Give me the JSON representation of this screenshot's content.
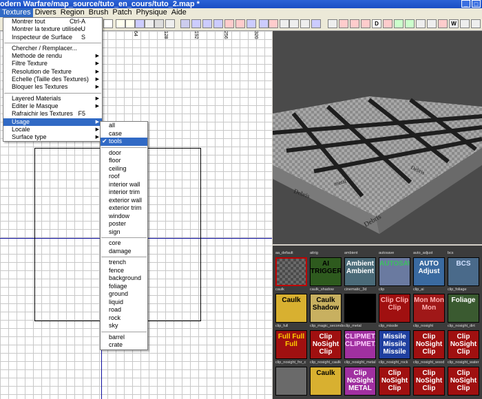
{
  "window": {
    "title": "odern Warfare/map_source/tuto_en_cours/tuto_2.map *"
  },
  "menubar": [
    "Textures",
    "Divers",
    "Region",
    "Brush",
    "Patch",
    "Physique",
    "Aide"
  ],
  "textures_menu": {
    "group1": [
      {
        "label": "Montrer tout",
        "shortcut": "Ctrl-A"
      },
      {
        "label": "Montrer la texture utilisée",
        "shortcut": "U"
      },
      {
        "label": "Inspecteur de Surface",
        "shortcut": "S"
      }
    ],
    "group2": [
      {
        "label": "Chercher / Remplacer..."
      },
      {
        "label": "Methode de rendu",
        "submenu": true
      },
      {
        "label": "Filtre Texture",
        "submenu": true
      },
      {
        "label": "Resolution de Texture",
        "submenu": true
      },
      {
        "label": "Echelle (Taille des Textures)",
        "submenu": true
      },
      {
        "label": "Bloquer les Textures",
        "submenu": true
      }
    ],
    "group3": [
      {
        "label": "Layered Materials",
        "submenu": true
      },
      {
        "label": "Editer le Masque",
        "submenu": true
      },
      {
        "label": "Rafraichir les Textures",
        "shortcut": "F5"
      },
      {
        "label": "Usage",
        "submenu": true,
        "highlighted": true
      },
      {
        "label": "Locale",
        "submenu": true
      },
      {
        "label": "Surface type",
        "submenu": true
      }
    ]
  },
  "usage_submenu": {
    "group1": [
      "all",
      "case",
      "tools"
    ],
    "selected": "tools",
    "group2": [
      "door",
      "floor",
      "ceiling",
      "roof",
      "interior wall",
      "interior trim",
      "exterior wall",
      "exterior trim",
      "window",
      "poster",
      "sign"
    ],
    "group3": [
      "core",
      "damage"
    ],
    "group4": [
      "trench",
      "fence",
      "background",
      "foliage",
      "ground",
      "liquid",
      "road",
      "rock",
      "sky"
    ],
    "group5": [
      "barrel",
      "crate"
    ]
  },
  "ruler_labels": [
    "64",
    "128",
    "192",
    "256",
    "320"
  ],
  "textures": [
    {
      "name": "aa_default",
      "text": "",
      "bg": "#5a5a5a",
      "fg": "#fff",
      "border": "#c00000"
    },
    {
      "name": "aitrig",
      "text": "AI TRIGGER",
      "bg": "#2e5a1e",
      "fg": "#000",
      "border": "#000"
    },
    {
      "name": "ambient",
      "text": "Ambient Ambient",
      "bg": "#4a6a78",
      "fg": "#fff",
      "border": "#000"
    },
    {
      "name": "autosave",
      "text": "AUTOSAVE",
      "bg": "#6a7aa0",
      "fg": "#3cc060",
      "border": "#000"
    },
    {
      "name": "auto_adjust",
      "text": "AUTO Adjust",
      "bg": "#3a6aa0",
      "fg": "#fff",
      "border": "#000"
    },
    {
      "name": "bcs",
      "text": "BCS",
      "bg": "#4a6a8a",
      "fg": "#d0e0ff",
      "border": "#000"
    },
    {
      "name": "caulk",
      "text": "Caulk",
      "bg": "#d8b030",
      "fg": "#000",
      "border": "#000"
    },
    {
      "name": "caulk_shadow",
      "text": "Caulk Shadow",
      "bg": "#c8b060",
      "fg": "#000",
      "border": "#000"
    },
    {
      "name": "cinematic_3d",
      "text": "",
      "bg": "#000",
      "fg": "#fff",
      "border": "#000"
    },
    {
      "name": "clip",
      "text": "Clip Clip Clip",
      "bg": "#a01010",
      "fg": "#ffb0b0",
      "border": "#000"
    },
    {
      "name": "clip_ai",
      "text": "Mon Mon Mon",
      "bg": "#a01818",
      "fg": "#ffb0b0",
      "border": "#000"
    },
    {
      "name": "clip_foliage",
      "text": "Foliage",
      "bg": "#3a5a30",
      "fg": "#ffffff",
      "border": "#000"
    },
    {
      "name": "clip_full",
      "text": "Full Full Full",
      "bg": "#a01010",
      "fg": "#ffd000",
      "border": "#000"
    },
    {
      "name": "clip_missile",
      "text": "Clip NoSight Clip",
      "bg": "#a01010",
      "fg": "#fff",
      "border": "#000"
    },
    {
      "name": "clip_metal",
      "text": "CLIPMETAL CLIPMETAL",
      "bg": "#a030a0",
      "fg": "#ffd0ff",
      "border": "#000"
    },
    {
      "name": "clip_missile2",
      "text": "Missile Missile Missile",
      "bg": "#2040a0",
      "fg": "#fff",
      "border": "#000"
    },
    {
      "name": "clip_nosight",
      "text": "Clip NoSight Clip",
      "bg": "#a01010",
      "fg": "#fff",
      "border": "#000"
    },
    {
      "name": "clip_nosight_dirt",
      "text": "Clip NoSight Clip",
      "bg": "#a01010",
      "fg": "#fff",
      "border": "#000"
    },
    {
      "name": "clip_nosight_fnr",
      "text": "",
      "bg": "#6a6a6a",
      "fg": "#fff",
      "border": "#000"
    },
    {
      "name": "clip_nosight_caulk",
      "text": "Caulk",
      "bg": "#d8b030",
      "fg": "#000",
      "border": "#000"
    },
    {
      "name": "clip_nosight_metal",
      "text": "Clip NoSight METAL",
      "bg": "#a030a0",
      "fg": "#fff",
      "border": "#000"
    },
    {
      "name": "clip_nosight_rock",
      "text": "Clip NoSight Clip",
      "bg": "#a01010",
      "fg": "#fff",
      "border": "#000"
    },
    {
      "name": "clip_nosight_wood",
      "text": "Clip NoSight Clip",
      "bg": "#a01010",
      "fg": "#fff",
      "border": "#000"
    },
    {
      "name": "clip_nosight_water",
      "text": "Clip NoSight Clip",
      "bg": "#a01010",
      "fg": "#fff",
      "border": "#000"
    }
  ],
  "texture_names": [
    "aa_default",
    "aitrig",
    "ambient",
    "autosave",
    "auto_adjust",
    "bcs",
    "caulk",
    "caulk_shadow",
    "cinematic_3d",
    "clip",
    "clip_ai",
    "clip_foliage",
    "clip_full",
    "clip_magic_seconds",
    "clip_metal",
    "clip_missile",
    "clip_nosight",
    "clip_nosight_dirt",
    "clip_nosight_fnr_c",
    "clip_nosight_caulk",
    "clip_nosight_metal",
    "clip_nosight_rock",
    "clip_nosight_wood",
    "clip_nosight_water"
  ],
  "viewport_labels": [
    "Debris",
    "Debris",
    "metal",
    "Debris"
  ]
}
